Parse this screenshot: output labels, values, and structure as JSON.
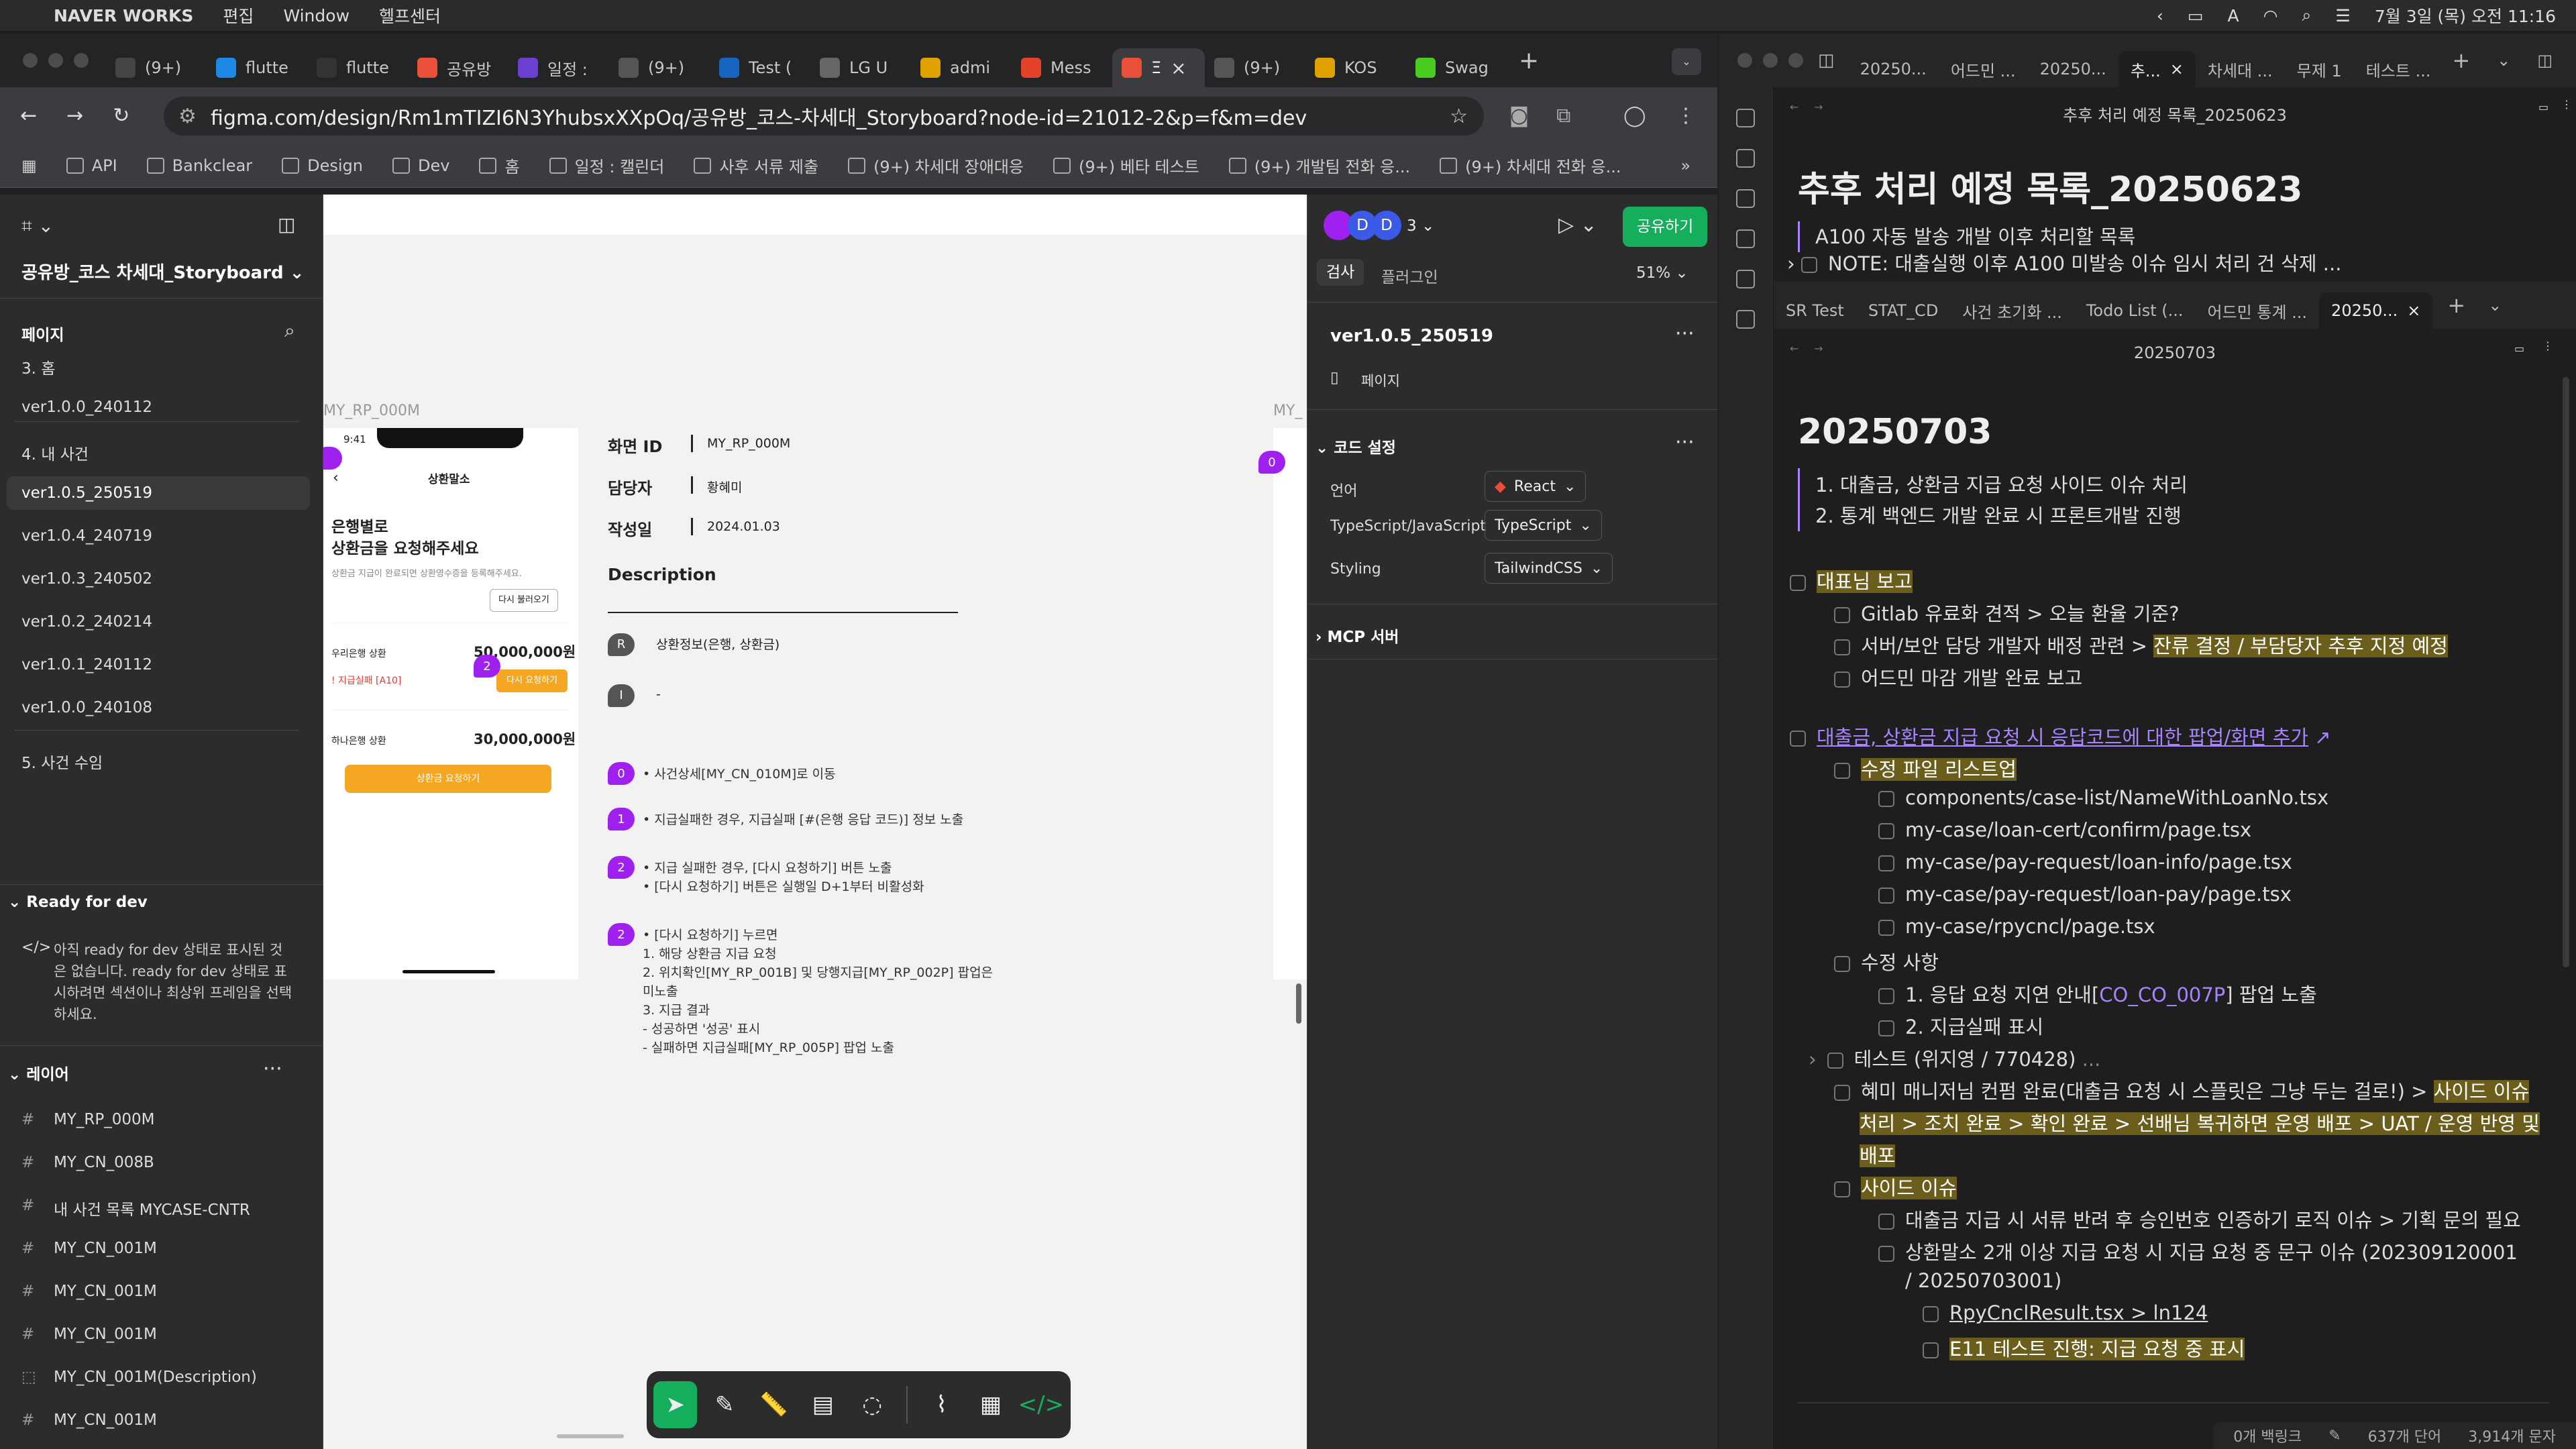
{
  "menubar": {
    "app": "NAVER WORKS",
    "items": [
      "편집",
      "Window",
      "헬프센터"
    ],
    "datetime": "7월 3일 (목) 오전 11:16"
  },
  "chrome": {
    "tabs": [
      {
        "label": "(9+)",
        "color": "#444"
      },
      {
        "label": "flutte",
        "color": "#1e88e5"
      },
      {
        "label": "flutte",
        "color": "#333"
      },
      {
        "label": "공유방",
        "color": "#e8503a"
      },
      {
        "label": "일정 :",
        "color": "#6a3fd1"
      },
      {
        "label": "(9+)",
        "color": "#555"
      },
      {
        "label": "Test (",
        "color": "#1565c0"
      },
      {
        "label": "LG U",
        "color": "#666"
      },
      {
        "label": "admi",
        "color": "#e0a000"
      },
      {
        "label": "Mess",
        "color": "#e24329"
      },
      {
        "label": "Ξ",
        "color": "#e8503a"
      },
      {
        "label": "(9+)",
        "color": "#555"
      },
      {
        "label": "KOS",
        "color": "#e0a000"
      },
      {
        "label": "Swag",
        "color": "#49cc20"
      }
    ],
    "url": "figma.com/design/Rm1mTIZI6N3YhubsxXXpOq/공유방_코스-차세대_Storyboard?node-id=21012-2&p=f&m=dev",
    "bookmarks": [
      "API",
      "Bankclear",
      "Design",
      "Dev",
      "홈",
      "일정 : 캘린더",
      "사후 서류 제출",
      "(9+) 차세대 장애대응",
      "(9+) 베타 테스트",
      "(9+) 개발팀 전화 응...",
      "(9+) 차세대 전화 응..."
    ]
  },
  "figma": {
    "file_name": "공유방_코스 차세대_Storyboard",
    "pages_label": "페이지",
    "pages": [
      {
        "label": "3. 홈"
      },
      {
        "label": "ver1.0.0_240112"
      },
      {
        "label": "4. 내 사건"
      },
      {
        "label": "ver1.0.5_250519",
        "selected": true
      },
      {
        "label": "ver1.0.4_240719"
      },
      {
        "label": "ver1.0.3_240502"
      },
      {
        "label": "ver1.0.2_240214"
      },
      {
        "label": "ver1.0.1_240112"
      },
      {
        "label": "ver1.0.0_240108"
      },
      {
        "label": "5. 사건 수임"
      }
    ],
    "ready_title": "Ready for dev",
    "ready_note": [
      "아직 ready for dev 상태로 표시된 것",
      "은 없습니다. ready for dev 상태로 표",
      "시하려면 섹션이나 최상위 프레임을 선택",
      "하세요."
    ],
    "layers_label": "레이어",
    "layers": [
      "MY_RP_000M",
      "MY_CN_008B",
      "내 사건 목록 MYCASE-CNTR",
      "MY_CN_001M",
      "MY_CN_001M",
      "MY_CN_001M",
      "MY_CN_001M(Description)",
      "MY_CN_001M"
    ],
    "right": {
      "tabs": [
        "검사",
        "플러그인"
      ],
      "zoom": "51%",
      "share": "공유하기",
      "avatar_count": "3",
      "page_name": "ver1.0.5_250519",
      "page_label": "페이지",
      "code_title": "코드 설정",
      "lang_label": "언어",
      "lang_value": "React",
      "ts_label": "TypeScript/JavaScript",
      "ts_value": "TypeScript",
      "styling_label": "Styling",
      "styling_value": "TailwindCSS",
      "mcp": "MCP 서버"
    },
    "canvas": {
      "frame_label": "MY_RP_000M",
      "frame_label2": "MY_",
      "phone": {
        "time": "9:41",
        "title": "상환말소",
        "heading1": "은행별로",
        "heading2": "상환금을 요청해주세요",
        "sub": "상환금 지급이 완료되면 상환영수증을 등록해주세요.",
        "reload": "다시 불러오기",
        "bank1": "우리은행 상환",
        "amount1": "50,000,000원",
        "fail": "지급실패 [A10]",
        "retry": "다시 요청하기",
        "bank2": "하나은행 상환",
        "amount2": "30,000,000원",
        "request": "상환금 요청하기"
      },
      "meta": [
        {
          "key": "화면 ID",
          "value": "MY_RP_000M"
        },
        {
          "key": "담당자",
          "value": "황혜미"
        },
        {
          "key": "작성일",
          "value": "2024.01.03"
        }
      ],
      "desc_title": "Description",
      "r_label": "R",
      "r_text": "상환정보(은행, 상환금)",
      "i_label": "I",
      "i_text": "-",
      "notes": [
        {
          "badge": "0",
          "lines": [
            "•  사건상세[MY_CN_010M]로 이동"
          ]
        },
        {
          "badge": "1",
          "lines": [
            "•  지급실패한 경우, 지급실패 [#(은행 응답 코드)] 정보 노출"
          ]
        },
        {
          "badge": "2",
          "lines": [
            "•  지급 실패한 경우, [다시 요청하기] 버튼 노출",
            "•  [다시 요청하기] 버튼은 실행일 D+1부터 비활성화"
          ]
        },
        {
          "badge": "2",
          "lines": [
            "•  [다시 요청하기] 누르면",
            "    1. 해당 상환금 지급 요청",
            "    2. 위치확인[MY_RP_001B] 및  당행지급[MY_RP_002P] 팝업은",
            "    미노출",
            "    3. 지급 결과",
            "     - 성공하면 '성공' 표시",
            "     - 실패하면 지급실패[MY_RP_005P] 팝업 노출"
          ]
        }
      ],
      "side_badge": "0"
    }
  },
  "obsidian": {
    "top_tabs": [
      "20250...",
      "어드민 ...",
      "20250...",
      "추...",
      "차세대 ...",
      "무제 1",
      "테스트 ..."
    ],
    "top_title": "추후 처리 예정 목록_20250623",
    "top_h1": "추후 처리 예정 목록_20250623",
    "top_lines": [
      "A100 자동 발송 개발 이후 처리할 목록",
      "NOTE: 대출실행 이후 A100 미발송 이슈 임시 처리 건 삭제"
    ],
    "bottom_tabs": [
      "SR Test",
      "STAT_CD",
      "사건 초기화 ...",
      "Todo List (...",
      "어드민 통계 ...",
      "20250..."
    ],
    "bottom_title": "20250703",
    "h1": "20250703",
    "intro": [
      "1. 대출금, 상환금 지급 요청 사이드 이슈 처리",
      "2. 통계 백엔드 개발 완료 시 프론트개발 진행"
    ],
    "todo1": "대표님 보고",
    "todo1_items": [
      "Gitlab 유료화 견적 > 오늘 환율 기준?",
      "서버/보안 담당 개발자 배정 관련 > ",
      "어드민 마감 개발 완료 보고"
    ],
    "todo1_hl": "잔류 결정 / 부담당자 추후 지정 예정",
    "todo2": "대출금, 상환금 지급 요청 시 응답코드에 대한 팝업/화면 추가",
    "files_title": "수정 파일 리스트업",
    "files": [
      "components/case-list/NameWithLoanNo.tsx",
      "my-case/loan-cert/confirm/page.tsx",
      "my-case/pay-request/loan-info/page.tsx",
      "my-case/pay-request/loan-pay/page.tsx",
      "my-case/rpycncl/page.tsx"
    ],
    "changes_title": "수정 사항",
    "change1_pre": "1. 응답 요청 지연 안내[",
    "change1_link": "CO_CO_007P",
    "change1_post": "] 팝업 노출",
    "change2": "2. 지급실패 표시",
    "test": "테스트 (위지영 / 770428)",
    "confirm_pre": "혜미 매니저님 컨펌 완료(대출금 요청 시 스플릿은 그냥 두는 걸로!) > ",
    "confirm_hl1": "사이드 이슈",
    "confirm_hl2": "처리 > 조치 완료 > 확인 완료 > 선배님 복귀하면 운영 배포 > UAT / 운영 반영 및",
    "confirm_hl3": "배포",
    "side_title": "사이드 이슈",
    "side1": "대출금 지급 시 서류 반려 후 승인번호 인증하기 로직 이슈 > 기획 문의 필요",
    "side2a": "상환말소 2개 이상 지급 요청 시 지급 요청 중 문구 이슈 (202309120001",
    "side2b": "/ 20250703001)",
    "side3": "RpyCnclResult.tsx > ln124",
    "side4": "E11 테스트 진행: 지급 요청 중 표시",
    "status_backlinks": "0개 백링크",
    "status_words": "637개 단어",
    "status_chars": "3,914개 문자"
  }
}
